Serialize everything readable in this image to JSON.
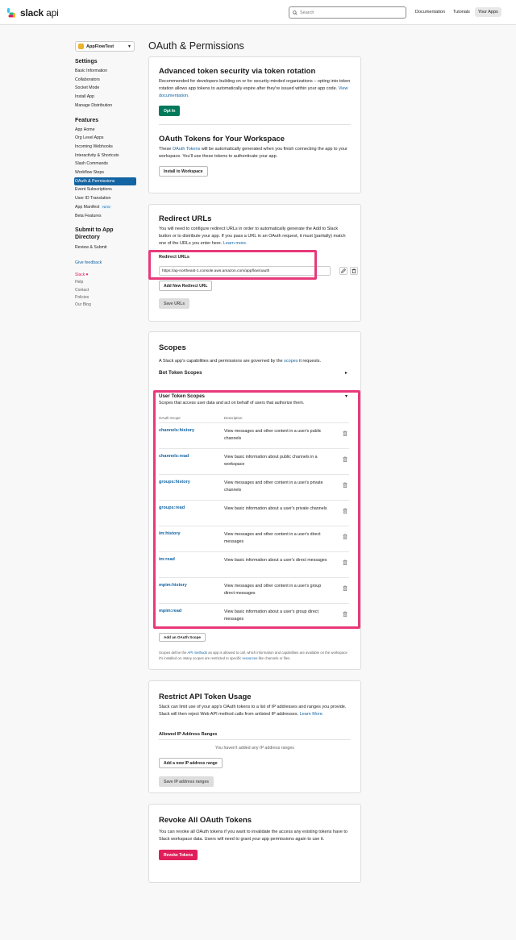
{
  "header": {
    "logo_text": "slack",
    "logo_api": "api",
    "search_placeholder": "Search",
    "nav": [
      "Documentation",
      "Tutorials",
      "Your Apps"
    ]
  },
  "sidebar": {
    "app_name": "AppFlowTest",
    "settings_heading": "Settings",
    "settings_items": [
      "Basic Information",
      "Collaborators",
      "Socket Mode",
      "Install App",
      "Manage Distribution"
    ],
    "features_heading": "Features",
    "features_items": [
      "App Home",
      "Org Level Apps",
      "Incoming Webhooks",
      "Interactivity & Shortcuts",
      "Slash Commands",
      "Workflow Steps",
      "OAuth & Permissions",
      "Event Subscriptions",
      "User ID Translation",
      "App Manifest",
      "Beta Features"
    ],
    "new_badge": "NEW",
    "submit_heading": "Submit to App Directory",
    "submit_items": [
      "Review & Submit"
    ],
    "give_feedback": "Give feedback",
    "footer_slack": "Slack",
    "footer_links": [
      "Help",
      "Contact",
      "Policies",
      "Our Blog"
    ]
  },
  "page": {
    "title": "OAuth & Permissions"
  },
  "token_security": {
    "title": "Advanced token security via token rotation",
    "text": "Recommended for developers building on or for security-minded organizations – opting into token rotation allows app tokens to automatically expire after they're issued within your app code.",
    "link": "View documentation.",
    "button": "Opt In"
  },
  "oauth_tokens": {
    "title": "OAuth Tokens for Your Workspace",
    "text_pre": "These",
    "text_link": "OAuth Tokens",
    "text_post": "will be automatically generated when you finish connecting the app to your workspace. You'll use these tokens to authenticate your app.",
    "button": "Install to Workspace"
  },
  "redirect": {
    "title": "Redirect URLs",
    "text": "You will need to configure redirect URLs in order to automatically generate the Add to Slack button or to distribute your app. If you pass a URL in an OAuth request, it must (partially) match one of the URLs you enter here.",
    "link": "Learn more.",
    "label": "Redirect URLs",
    "url_value": "https://ap-northeast-1.console.aws.amazon.com/appflow/oauth",
    "add_button": "Add New Redirect URL",
    "save_button": "Save URLs"
  },
  "scopes": {
    "title": "Scopes",
    "text_pre": "A Slack app's capabilities and permissions are governed by the",
    "text_link": "scopes",
    "text_post": "it requests.",
    "bot_title": "Bot Token Scopes",
    "user_title": "User Token Scopes",
    "user_desc": "Scopes that access user data and act on behalf of users that authorize them.",
    "col_scope": "OAuth Scope",
    "col_desc": "Description",
    "rows": [
      {
        "name": "channels:history",
        "desc": "View messages and other content in a user's public channels"
      },
      {
        "name": "channels:read",
        "desc": "View basic information about public channels in a workspace"
      },
      {
        "name": "groups:history",
        "desc": "View messages and other content in a user's private channels"
      },
      {
        "name": "groups:read",
        "desc": "View basic information about a user's private channels"
      },
      {
        "name": "im:history",
        "desc": "View messages and other content in a user's direct messages"
      },
      {
        "name": "im:read",
        "desc": "View basic information about a user's direct messages"
      },
      {
        "name": "mpim:history",
        "desc": "View messages and other content in a user's group direct messages"
      },
      {
        "name": "mpim:read",
        "desc": "View basic information about a user's group direct messages"
      }
    ],
    "add_button": "Add an OAuth Scope",
    "footnote_pre": "Scopes define the",
    "footnote_link1": "API methods",
    "footnote_mid": "an app is allowed to call, which information and capabilities are available on the workspace it's installed on. Many scopes are restricted to specific",
    "footnote_link2": "resources",
    "footnote_post": "like channels or files."
  },
  "restrict": {
    "title": "Restrict API Token Usage",
    "text": "Slack can limit use of your app's OAuth tokens to a list of IP addresses and ranges you provide. Slack will then reject Web API method calls from unlisted IP addresses.",
    "link": "Learn More.",
    "label": "Allowed IP Address Ranges",
    "empty": "You haven't added any IP address ranges",
    "add_button": "Add a new IP address range",
    "save_button": "Save IP address ranges"
  },
  "revoke": {
    "title": "Revoke All OAuth Tokens",
    "text": "You can revoke all OAuth tokens if you want to invalidate the access any existing tokens have to Slack workspace data. Users will need to grant your app permissions again to use it.",
    "button": "Revoke Tokens"
  },
  "colors": {
    "link": "#1264a3",
    "green": "#007a5a",
    "red": "#e01e5a",
    "highlight": "#e8397a"
  }
}
